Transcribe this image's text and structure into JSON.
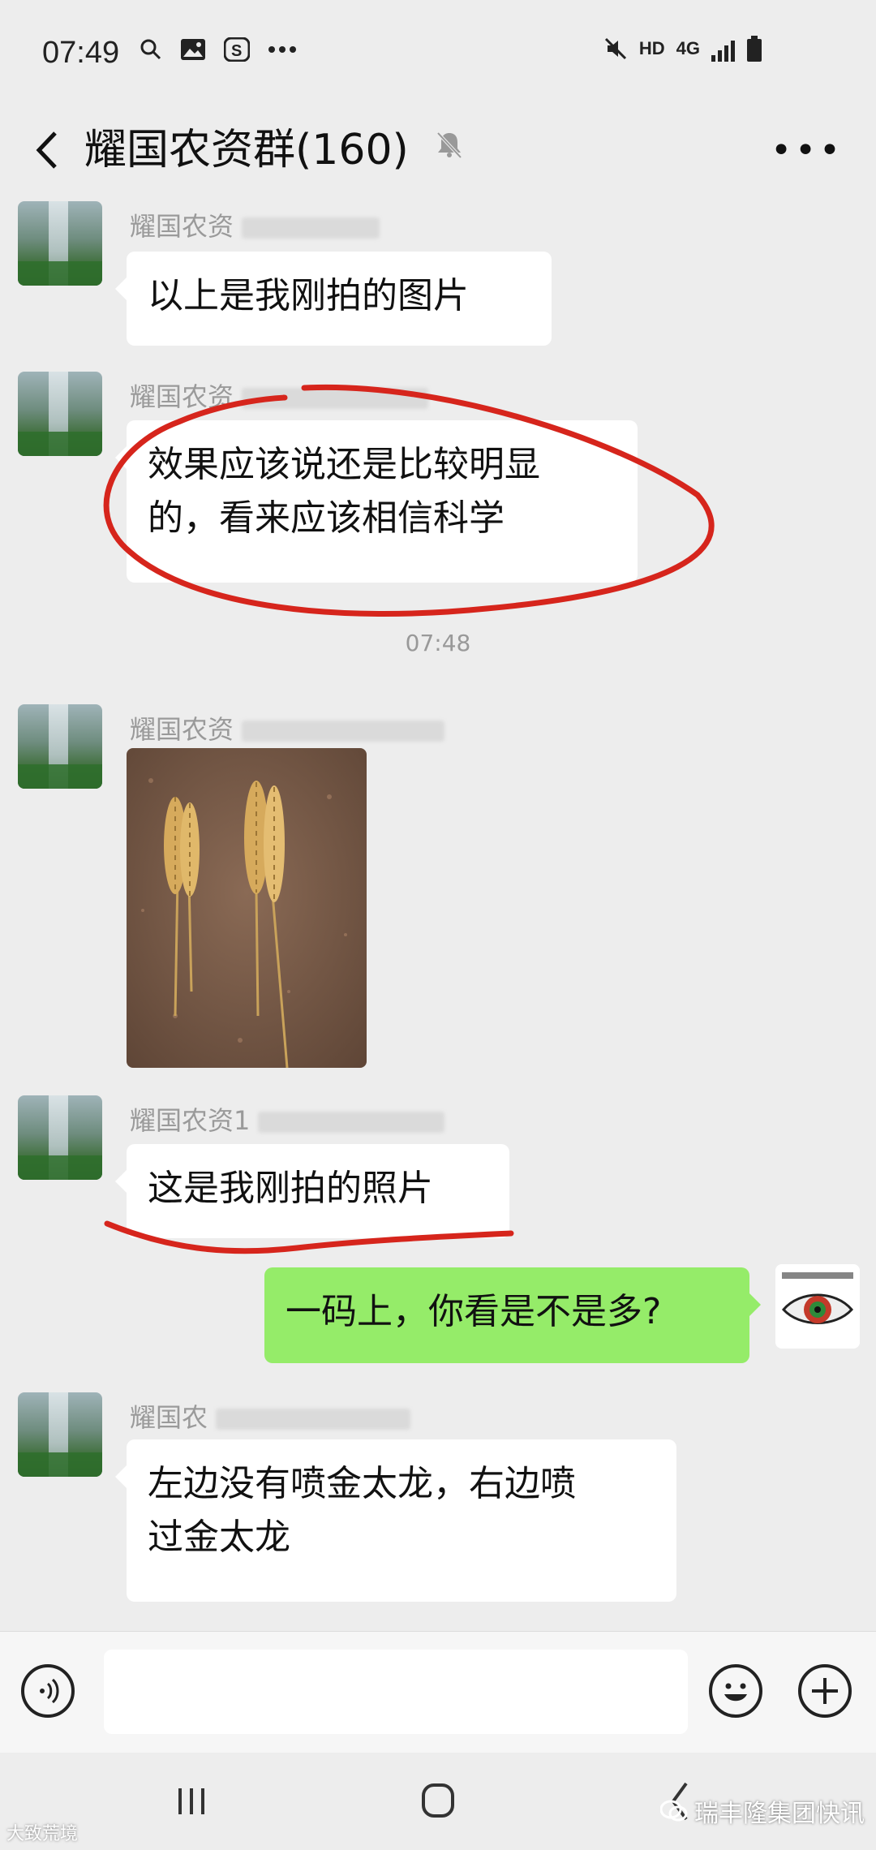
{
  "status": {
    "time": "07:49",
    "network": "4G",
    "hd": "HD"
  },
  "header": {
    "title": "耀国农资群(160)"
  },
  "messages": [
    {
      "sender": "耀国农资",
      "text": "以上是我刚拍的图片"
    },
    {
      "sender": "耀国农资",
      "line1": "效果应该说还是比较明显",
      "line2": "的，看来应该相信科学"
    },
    {
      "timestamp": "07:48"
    },
    {
      "sender": "耀国农资",
      "type": "image"
    },
    {
      "sender": "耀国农资1",
      "text": "这是我刚拍的照片"
    },
    {
      "self": true,
      "text": "一码上，你看是不是多?"
    },
    {
      "sender": "耀国农",
      "line1": "左边没有喷金太龙，右边喷",
      "line2": "过金太龙"
    }
  ],
  "watermarks": {
    "left": "大致荒境",
    "right": "瑞丰隆集团快讯"
  },
  "colors": {
    "self_bubble": "#95ec69",
    "annotation": "#d6251c"
  },
  "icons": [
    "back-arrow-icon",
    "mute-icon",
    "more-icon",
    "voice-icon",
    "emoji-icon",
    "plus-icon",
    "recents-icon",
    "home-icon",
    "back-nav-icon"
  ]
}
